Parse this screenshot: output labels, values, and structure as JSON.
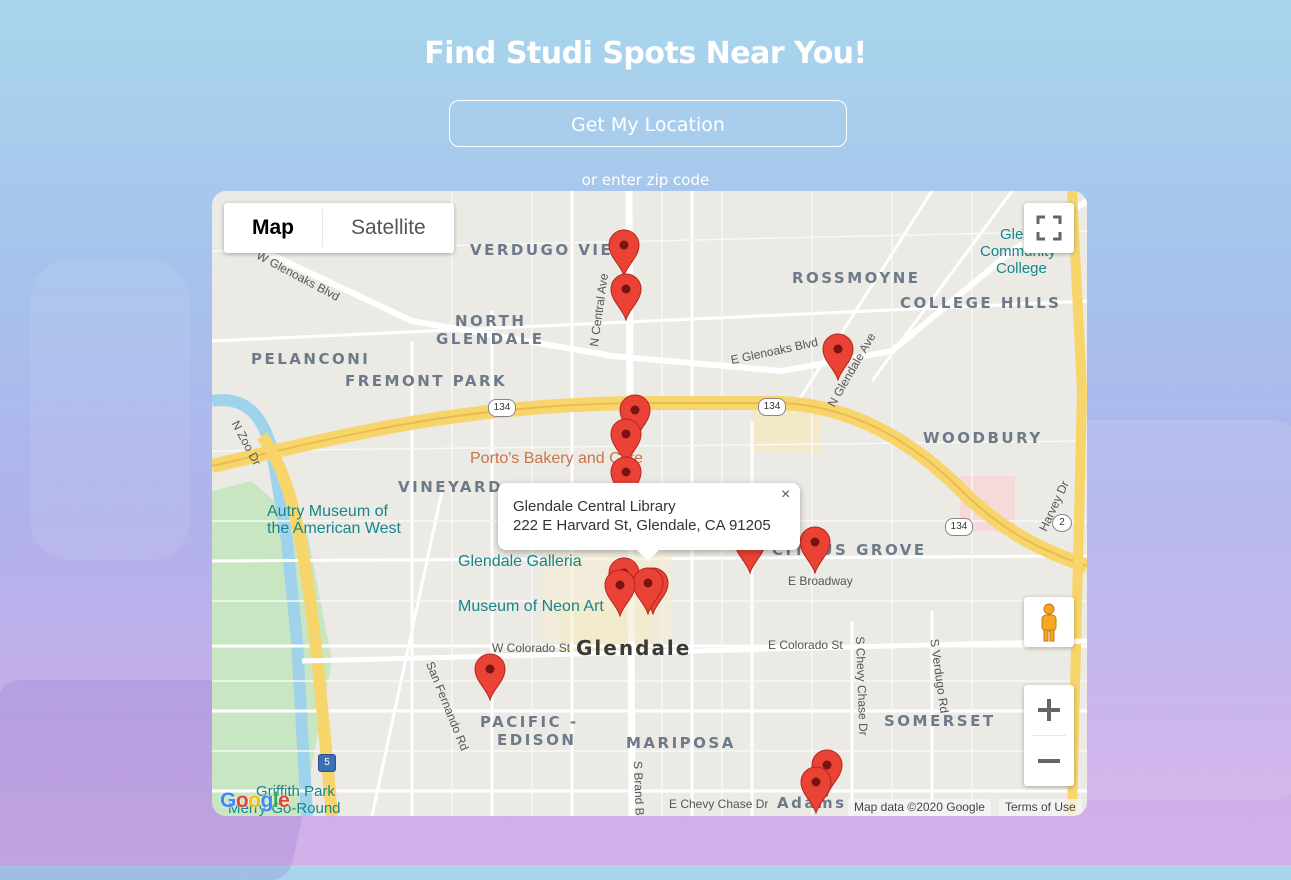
{
  "page": {
    "title": "Find Studi Spots Near You!",
    "location_button": "Get My Location",
    "zip_prompt": "or enter zip code"
  },
  "map": {
    "type_control": {
      "map_label": "Map",
      "satellite_label": "Satellite",
      "active": "Map"
    },
    "neighborhoods": [
      "VERDUGO VIEJO",
      "ROSSMOYNE",
      "COLLEGE HILLS",
      "NORTH",
      "GLENDALE",
      "PELANCONI",
      "FREMONT PARK",
      "WOODBURY",
      "VINEYARD",
      "CITRUS GROVE",
      "PACIFIC -",
      "EDISON",
      "MARIPOSA",
      "SOMERSET",
      "Adams"
    ],
    "city_label": "Glendale",
    "streets": [
      "W Glenoaks Blvd",
      "N Central Ave",
      "E Glenoaks Blvd",
      "N Glendale Ave",
      "N Zoo Dr",
      "Harvey Dr",
      "E Broadway",
      "W Colorado St",
      "E Colorado St",
      "S Chevy Chase Dr",
      "S Verdugo Rd",
      "San Fernando Rd",
      "S Brand Blvd",
      "E Chevy Chase Dr"
    ],
    "pois": [
      "Porto's Bakery and Cafe",
      "Glendale Galleria",
      "Museum of Neon Art",
      "Autry Museum of",
      "the American West",
      "Griffith Park",
      "Merry-Go-Round",
      "Glendale",
      "Community",
      "College"
    ],
    "highways": [
      "134",
      "134",
      "134",
      "2",
      "5"
    ],
    "info_window": {
      "name": "Glendale Central Library",
      "address": "222 E Harvard St, Glendale, CA 91205",
      "close": "×"
    },
    "attribution": {
      "data": "Map data ©2020 Google",
      "terms": "Terms of Use",
      "logo": "Google"
    },
    "marker_count": 17
  },
  "colors": {
    "marker": "#ea4335",
    "highway": "#f7d56b",
    "poi_teal": "#16858c",
    "poi_orange": "#c8744a"
  },
  "icons": [
    "fullscreen-icon",
    "pegman-icon",
    "zoom-in-icon",
    "zoom-out-icon",
    "close-icon",
    "map-marker-icon"
  ]
}
